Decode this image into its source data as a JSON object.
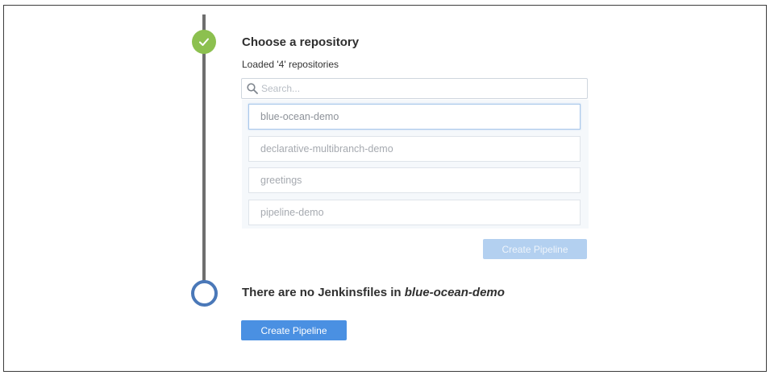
{
  "steps": {
    "choose": {
      "status_icon": "check-icon",
      "title": "Choose a repository",
      "subtitle": "Loaded '4' repositories",
      "search": {
        "placeholder": "Search...",
        "icon": "search-icon"
      },
      "repositories": [
        {
          "name": "blue-ocean-demo",
          "selected": true
        },
        {
          "name": "declarative-multibranch-demo",
          "selected": false
        },
        {
          "name": "greetings",
          "selected": false
        },
        {
          "name": "pipeline-demo",
          "selected": false
        }
      ],
      "create_button_label": "Create Pipeline",
      "create_button_enabled": false
    },
    "jenkinsfile": {
      "status_icon": "pending-circle-icon",
      "heading_prefix": "There are no Jenkinsfiles in ",
      "heading_repo": "blue-ocean-demo",
      "create_button_label": "Create Pipeline"
    }
  },
  "colors": {
    "complete": "#8cc04f",
    "pending": "#4a78b8",
    "primary_button": "#4a90e2",
    "disabled_button": "#b3d0f0",
    "timeline": "#6e6e6e"
  }
}
